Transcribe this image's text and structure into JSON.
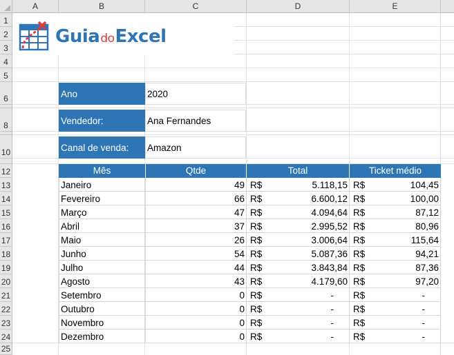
{
  "sheet": {
    "columns": [
      "A",
      "B",
      "C",
      "D",
      "E"
    ],
    "rows": [
      "1",
      "2",
      "3",
      "4",
      "5",
      "6",
      "7",
      "8",
      "9",
      "10",
      "11",
      "12",
      "13",
      "14",
      "15",
      "16",
      "17",
      "18",
      "19",
      "20",
      "21",
      "22",
      "23",
      "24",
      "25"
    ]
  },
  "logo": {
    "part1": "Guia",
    "part2": "do",
    "part3": "Excel"
  },
  "info": {
    "ano_label": "Ano",
    "ano_value": "2020",
    "vendedor_label": "Vendedor:",
    "vendedor_value": "Ana Fernandes",
    "canal_label": "Canal de venda:",
    "canal_value": "Amazon"
  },
  "table": {
    "headers": {
      "mes": "Mês",
      "qtde": "Qtde",
      "total": "Total",
      "ticket": "Ticket médio"
    },
    "currency": "R$",
    "rows": [
      {
        "mes": "Janeiro",
        "qtde": "49",
        "total": "5.118,15",
        "ticket": "104,45"
      },
      {
        "mes": "Fevereiro",
        "qtde": "66",
        "total": "6.600,12",
        "ticket": "100,00"
      },
      {
        "mes": "Março",
        "qtde": "47",
        "total": "4.094,64",
        "ticket": "87,12"
      },
      {
        "mes": "Abril",
        "qtde": "37",
        "total": "2.995,52",
        "ticket": "80,96"
      },
      {
        "mes": "Maio",
        "qtde": "26",
        "total": "3.006,64",
        "ticket": "115,64"
      },
      {
        "mes": "Junho",
        "qtde": "54",
        "total": "5.087,36",
        "ticket": "94,21"
      },
      {
        "mes": "Julho",
        "qtde": "44",
        "total": "3.843,84",
        "ticket": "87,36"
      },
      {
        "mes": "Agosto",
        "qtde": "43",
        "total": "4.179,60",
        "ticket": "97,20"
      },
      {
        "mes": "Setembro",
        "qtde": "0",
        "total": "-",
        "ticket": "-"
      },
      {
        "mes": "Outubro",
        "qtde": "0",
        "total": "-",
        "ticket": "-"
      },
      {
        "mes": "Novembro",
        "qtde": "0",
        "total": "-",
        "ticket": "-"
      },
      {
        "mes": "Dezembro",
        "qtde": "0",
        "total": "-",
        "ticket": "-"
      }
    ]
  },
  "colors": {
    "accent": "#2e75b6",
    "logo_red": "#e03a3e",
    "header_bg": "#e6e6e6"
  }
}
